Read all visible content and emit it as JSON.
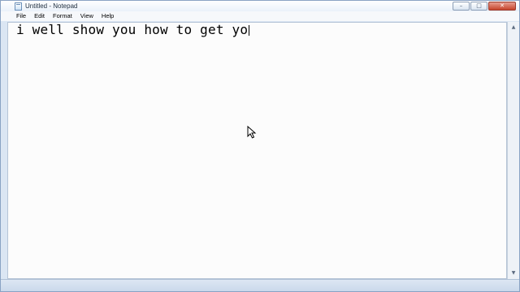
{
  "window": {
    "title": "Untitled - Notepad",
    "icon": "notepad-icon"
  },
  "caption_buttons": {
    "minimize": "–",
    "maximize": "□",
    "close": "✕"
  },
  "menu": {
    "items": [
      {
        "label": "File"
      },
      {
        "label": "Edit"
      },
      {
        "label": "Format"
      },
      {
        "label": "View"
      },
      {
        "label": "Help"
      }
    ]
  },
  "editor": {
    "content": "i well show you how to get yo"
  },
  "scrollbar": {
    "up_arrow": "▲",
    "down_arrow": "▼"
  },
  "colors": {
    "close_button": "#c6442b",
    "frame": "#dbe6f3"
  }
}
